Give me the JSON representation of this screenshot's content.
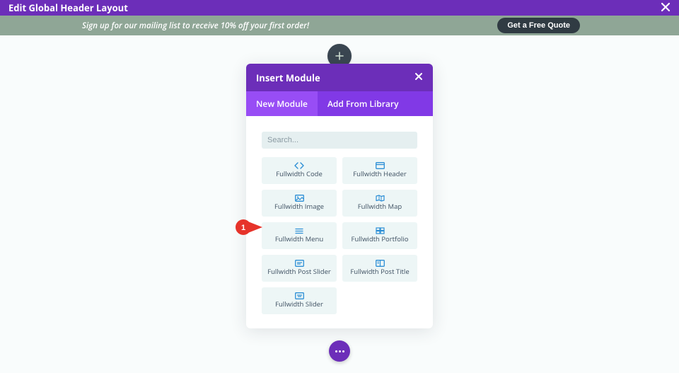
{
  "topbar": {
    "title": "Edit Global Header Layout"
  },
  "promo": {
    "text": "Sign up for our mailing list to receive  10% off your first order!",
    "cta": "Get a Free Quote"
  },
  "modal": {
    "title": "Insert Module",
    "tabs": {
      "new": "New Module",
      "library": "Add From Library"
    },
    "search_placeholder": "Search...",
    "modules": {
      "code": "Fullwidth Code",
      "header": "Fullwidth Header",
      "image": "Fullwidth Image",
      "map": "Fullwidth Map",
      "menu": "Fullwidth Menu",
      "portfolio": "Fullwidth Portfolio",
      "post_slider": "Fullwidth Post Slider",
      "post_title": "Fullwidth Post Title",
      "slider": "Fullwidth Slider"
    }
  },
  "annotation": {
    "number": "1"
  },
  "colors": {
    "purple": "#6c2eb9",
    "purple_light": "#8139e6",
    "purple_tab_active": "#984df5",
    "sage": "#8fa696",
    "dark": "#303b43",
    "card_bg": "#edf6f6",
    "icon_blue": "#2d8fd6"
  }
}
